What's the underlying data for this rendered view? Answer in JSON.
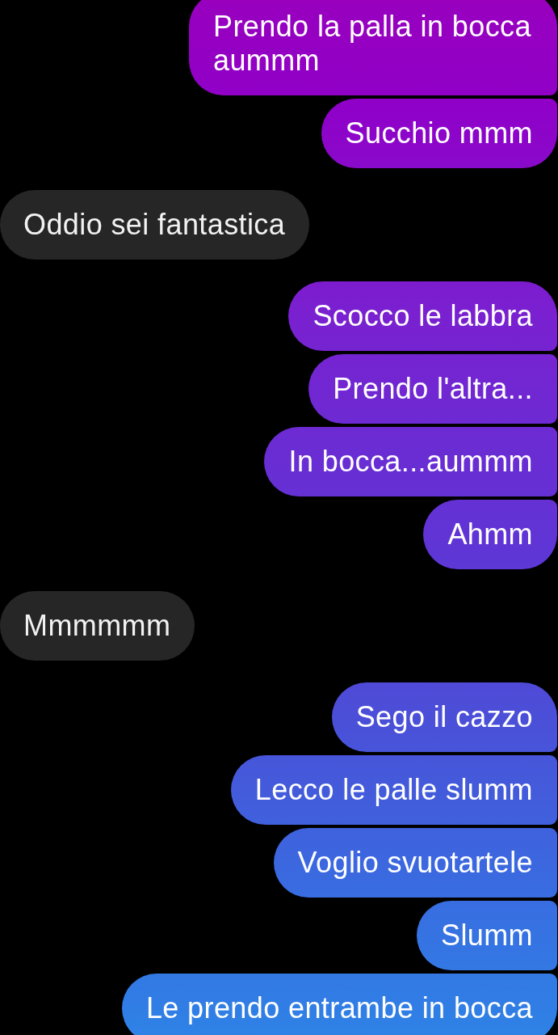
{
  "messages": [
    {
      "kind": "sent",
      "text": "Prendo la palla in bocca aummm"
    },
    {
      "kind": "sent",
      "text": "Succhio mmm"
    },
    {
      "kind": "received",
      "text": "Oddio sei fantastica"
    },
    {
      "kind": "sent",
      "text": "Scocco le labbra"
    },
    {
      "kind": "sent",
      "text": "Prendo l'altra..."
    },
    {
      "kind": "sent",
      "text": "In bocca...aummm"
    },
    {
      "kind": "sent",
      "text": "Ahmm"
    },
    {
      "kind": "received",
      "text": "Mmmmmm"
    },
    {
      "kind": "sent",
      "text": "Sego il cazzo"
    },
    {
      "kind": "sent",
      "text": "Lecco le palle slumm"
    },
    {
      "kind": "sent",
      "text": "Voglio svuotartele"
    },
    {
      "kind": "sent",
      "text": "Slumm"
    },
    {
      "kind": "sent",
      "text": "Le prendo entrambe in bocca"
    }
  ]
}
